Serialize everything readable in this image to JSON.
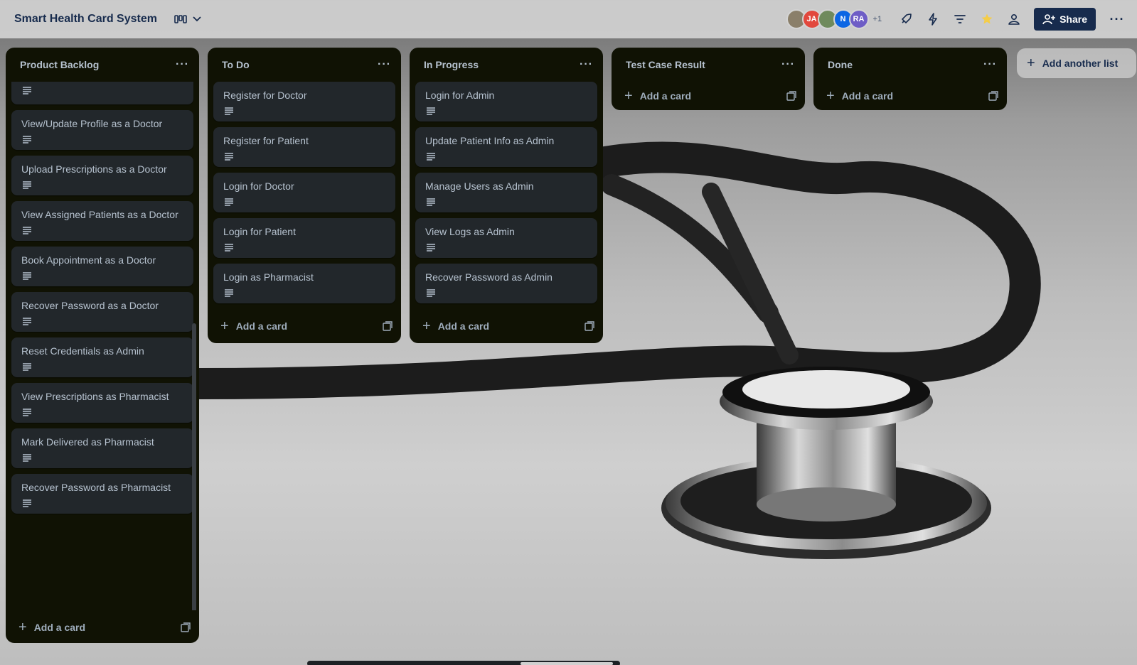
{
  "header": {
    "title": "Smart Health Card System",
    "avatars": [
      {
        "initials": "",
        "color": "#8a7f6a"
      },
      {
        "initials": "JA",
        "color": "#e2483d"
      },
      {
        "initials": "",
        "color": "#6f8a5c"
      },
      {
        "initials": "N",
        "color": "#0c66e4"
      },
      {
        "initials": "RA",
        "color": "#6e5dc6"
      }
    ],
    "avatar_more": "+1",
    "share_label": "Share"
  },
  "lists": [
    {
      "title": "Product Backlog",
      "cards": [
        "View/Update Profile as a Doctor",
        "Upload Prescriptions as a Doctor",
        "View Assigned Patients as a Doctor",
        "Book Appointment as a Doctor",
        "Recover Password as a Doctor",
        "Reset Credentials as Admin",
        "View Prescriptions as Pharmacist",
        "Mark Delivered as Pharmacist",
        "Recover Password as Pharmacist"
      ],
      "add_label": "Add a card"
    },
    {
      "title": "To Do",
      "cards": [
        "Register for Doctor",
        "Register for Patient",
        "Login for Doctor",
        "Login for Patient",
        "Login as Pharmacist"
      ],
      "add_label": "Add a card"
    },
    {
      "title": "In Progress",
      "cards": [
        "Login for Admin",
        "Update Patient Info as Admin",
        "Manage Users as Admin",
        "View Logs as Admin",
        "Recover Password as Admin"
      ],
      "add_label": "Add a card"
    },
    {
      "title": "Test Case Result",
      "cards": [],
      "add_label": "Add a card"
    },
    {
      "title": "Done",
      "cards": [],
      "add_label": "Add a card"
    }
  ],
  "add_list_label": "Add another list",
  "colors": {
    "list_bg": "#101204",
    "card_bg": "#22272b",
    "text": "#b6c2cf",
    "share_bg": "#172b4d",
    "star": "#f5cd47"
  }
}
